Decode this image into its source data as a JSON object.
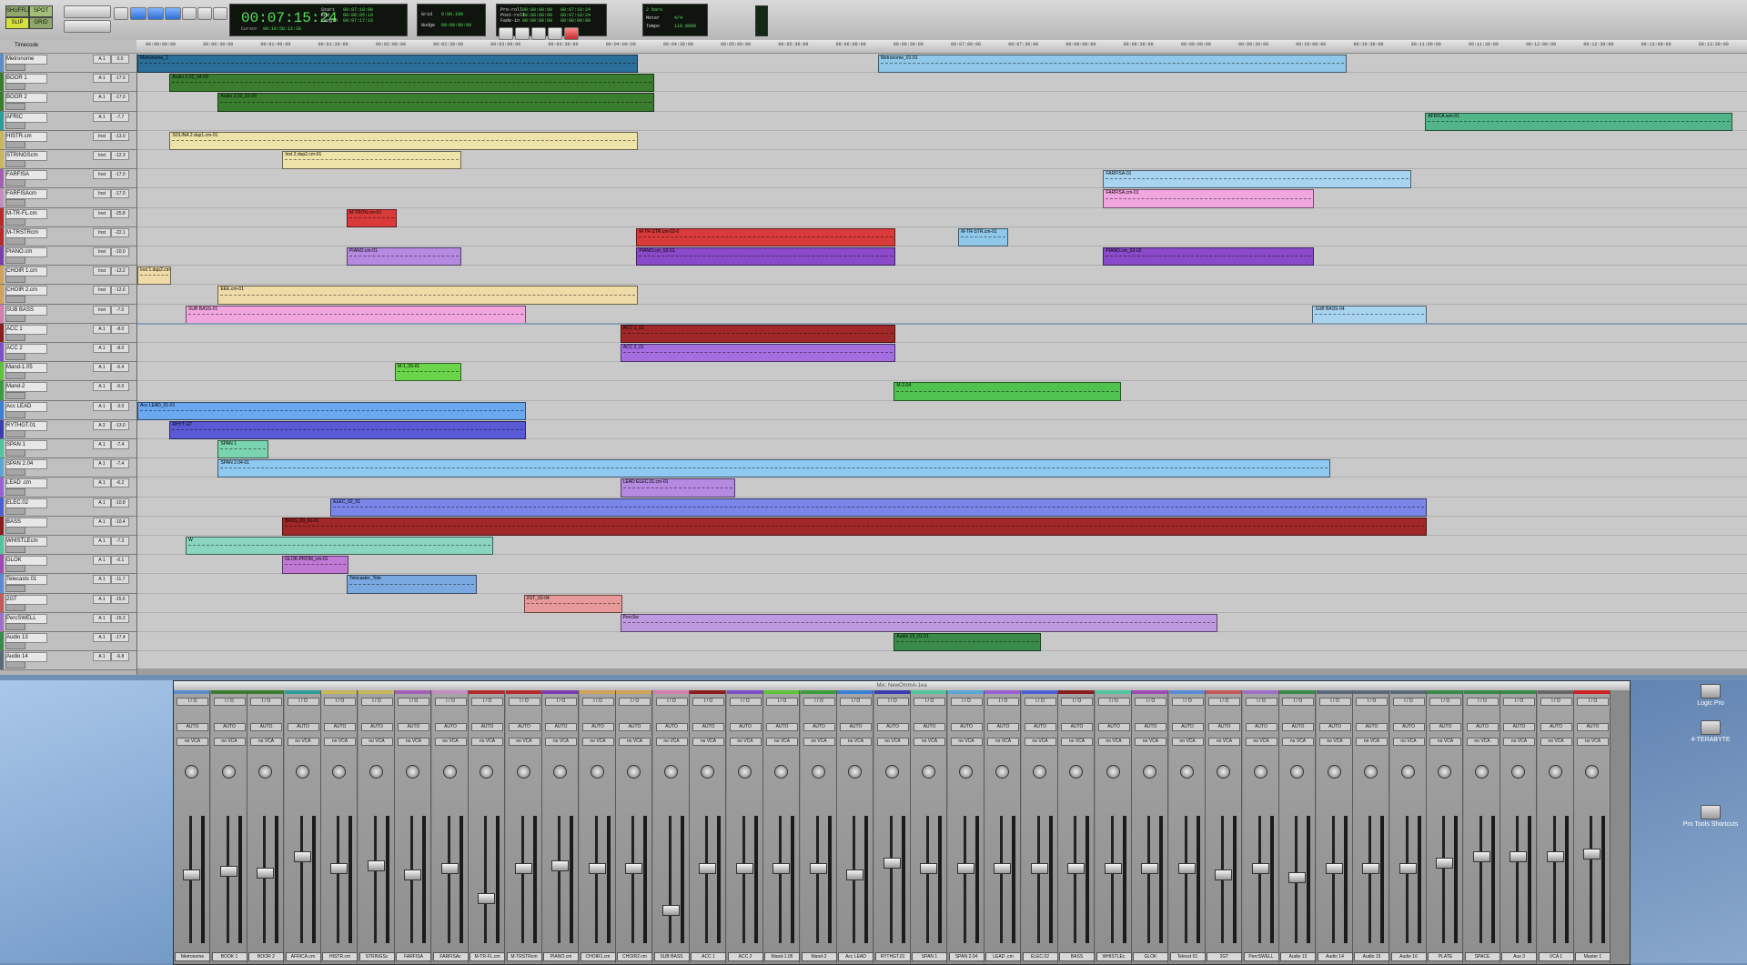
{
  "toolbar": {
    "modes": [
      "SHUFFLE",
      "SPOT",
      "SLIP",
      "GRID"
    ],
    "main_counter": "00:07:15:24",
    "start_label": "Start",
    "end_label": "End",
    "length_label": "Length",
    "start": "00:07:18:00",
    "end": "00:08:05:10",
    "length": "00:07:17:16",
    "cursor_label": "Cursor",
    "cursor": "00:10:58:12:28",
    "grid_label": "Grid",
    "grid": "0:00.100",
    "nudge_label": "Nudge",
    "nudge": "00:00:00:00",
    "preroll_label": "Pre-roll",
    "postroll_label": "Post-roll",
    "fadein_label": "Fade-in",
    "preroll": "00:00:00:00",
    "postroll": "00:00:00:00",
    "fadein": "00:00:00:00",
    "tstart": "00:07:18:24",
    "tend": "00:07:18:24",
    "tlength": "00:00:00:00",
    "meter_label": "Meter",
    "tempo_label": "Tempo",
    "meter": "4/4",
    "tempo": "110.0000",
    "countoff": "2 bars"
  },
  "ruler": {
    "timecode_label": "Timecode",
    "ticks": [
      "00:00:00:00",
      "00:00:30:00",
      "00:01:00:00",
      "00:01:30:00",
      "00:02:00:00",
      "00:02:30:00",
      "00:03:00:00",
      "00:03:30:00",
      "00:04:00:00",
      "00:04:30:00",
      "00:05:00:00",
      "00:05:30:00",
      "00:06:00:00",
      "00:06:30:00",
      "00:07:00:00",
      "00:07:30:00",
      "00:08:00:00",
      "00:08:30:00",
      "00:09:00:00",
      "00:09:30:00",
      "00:10:00:00",
      "00:10:30:00",
      "00:11:00:00",
      "00:11:30:00",
      "00:12:00:00",
      "00:12:30:00",
      "00:13:00:00",
      "00:13:30:00"
    ]
  },
  "tracks": [
    {
      "name": "Metronome",
      "color": "#5b8dc9",
      "input": "A 1",
      "vol": "0.0"
    },
    {
      "name": "BOOR 1",
      "color": "#3a7d2f",
      "input": "A 1",
      "vol": "-17.0"
    },
    {
      "name": "BOOR 2",
      "color": "#3a7d2f",
      "input": "A 1",
      "vol": "-17.0"
    },
    {
      "name": "AFRIC",
      "color": "#2c9e9a",
      "input": "A 1",
      "vol": "-7.7"
    },
    {
      "name": "HISTR.cm",
      "color": "#c9b85a",
      "input": "Inst",
      "vol": "-13.0"
    },
    {
      "name": "STRINGScm",
      "color": "#c9b85a",
      "input": "Inst",
      "vol": "-12.3"
    },
    {
      "name": "FARFISA",
      "color": "#a35fb5",
      "input": "Inst",
      "vol": "-17.0"
    },
    {
      "name": "FARFISAcm",
      "color": "#c68dbf",
      "input": "Inst",
      "vol": "-17.0"
    },
    {
      "name": "M-TR-FL.cm",
      "color": "#b52a2a",
      "input": "Inst",
      "vol": "-25.8"
    },
    {
      "name": "M-TRSTRcm",
      "color": "#b52a2a",
      "input": "Inst",
      "vol": "-22.1"
    },
    {
      "name": "PIANO.cm",
      "color": "#7a3cb0",
      "input": "Inst",
      "vol": "-10.0"
    },
    {
      "name": "CHOIR 1.cm",
      "color": "#d1a25a",
      "input": "Inst",
      "vol": "-13.2"
    },
    {
      "name": "CHOIR 2.cm",
      "color": "#d1a25a",
      "input": "Inst",
      "vol": "-12.0"
    },
    {
      "name": "SUB BASS",
      "color": "#d27fb0",
      "input": "Inst",
      "vol": "-7.0"
    },
    {
      "name": "ACC 1",
      "color": "#8a1e1e",
      "input": "A 1",
      "vol": "-8.0"
    },
    {
      "name": "ACC 2",
      "color": "#7d4fc9",
      "input": "A 1",
      "vol": "-8.0"
    },
    {
      "name": "Mand-1.05",
      "color": "#5fc23b",
      "input": "A 1",
      "vol": "-6.4"
    },
    {
      "name": "Mand-2",
      "color": "#3a9c3a",
      "input": "A 1",
      "vol": "-6.0"
    },
    {
      "name": "Acc LEAD",
      "color": "#3b7ed6",
      "input": "A 1",
      "vol": "-3.0"
    },
    {
      "name": "RYTHGT.01",
      "color": "#3a3cb0",
      "input": "A 2",
      "vol": "-13.0"
    },
    {
      "name": "SPAN 1",
      "color": "#52c49a",
      "input": "A 1",
      "vol": "-7.4"
    },
    {
      "name": "SPAN 2.04",
      "color": "#5aa6d6",
      "input": "A 1",
      "vol": "-7.4"
    },
    {
      "name": "LEAD .cm",
      "color": "#9b5fd6",
      "input": "A 1",
      "vol": "-6.2"
    },
    {
      "name": "ELEC.02",
      "color": "#4a5fd6",
      "input": "A 1",
      "vol": "-10.8"
    },
    {
      "name": "BASS",
      "color": "#8a1e1e",
      "input": "A 1",
      "vol": "-10.4"
    },
    {
      "name": "WHISTLEcm",
      "color": "#52c4a0",
      "input": "A 1",
      "vol": "-7.3"
    },
    {
      "name": "GLOK",
      "color": "#a04ab5",
      "input": "A 1",
      "vol": "-0.1"
    },
    {
      "name": "Telecasts 01",
      "color": "#5a8bd6",
      "input": "A 1",
      "vol": "-11.7"
    },
    {
      "name": "2GT",
      "color": "#c25a5a",
      "input": "A 1",
      "vol": "-15.6"
    },
    {
      "name": "PercSWELL",
      "color": "#a070c9",
      "input": "A 1",
      "vol": "-15.2"
    },
    {
      "name": "Audio 13",
      "color": "#3a8a4a",
      "input": "A 1",
      "vol": "-17.4"
    },
    {
      "name": "Audio 14",
      "color": "#5b6a7a",
      "input": "A 1",
      "vol": "-6.8"
    }
  ],
  "regions": [
    {
      "track": 0,
      "name": "Metronome_1",
      "color": "#2a6f9a",
      "start": 0.0,
      "end": 0.31
    },
    {
      "track": 0,
      "name": "Metronome_01-01",
      "color": "#8fc8e8",
      "start": 0.46,
      "end": 0.75
    },
    {
      "track": 1,
      "name": "Audio 2.02_04-09",
      "color": "#3a7d2f",
      "start": 0.02,
      "end": 0.32
    },
    {
      "track": 2,
      "name": "Audio 3.02_03-09",
      "color": "#3a7d2f",
      "start": 0.05,
      "end": 0.32
    },
    {
      "track": 3,
      "name": "AFRICA.wm-01",
      "color": "#52b58a",
      "start": 0.8,
      "end": 0.99
    },
    {
      "track": 4,
      "name": "SOLINA 2.dup1.cm-01",
      "color": "#eee3a8",
      "start": 0.02,
      "end": 0.31
    },
    {
      "track": 5,
      "name": "Inst 2.dup2.cm-01",
      "color": "#eee3a8",
      "start": 0.09,
      "end": 0.2
    },
    {
      "track": 6,
      "name": "FARFISA-01",
      "color": "#a8d4f0",
      "start": 0.6,
      "end": 0.79
    },
    {
      "track": 7,
      "name": "FARFISA.cm-01",
      "color": "#f2a6e0",
      "start": 0.6,
      "end": 0.73
    },
    {
      "track": 8,
      "name": "M-TRON.cm-01",
      "color": "#d93a3a",
      "start": 0.13,
      "end": 0.16
    },
    {
      "track": 9,
      "name": "M-TR-STR.cm-02-0",
      "color": "#d93a3a",
      "start": 0.31,
      "end": 0.47
    },
    {
      "track": 9,
      "name": "M-TR-STR.cm-01",
      "color": "#8fc8e8",
      "start": 0.51,
      "end": 0.54
    },
    {
      "track": 10,
      "name": "PIANO.cm-01",
      "color": "#b58ae0",
      "start": 0.13,
      "end": 0.2
    },
    {
      "track": 10,
      "name": "PIANO.cm_02-01",
      "color": "#8a4ac9",
      "start": 0.31,
      "end": 0.47
    },
    {
      "track": 10,
      "name": "PIANO.cm_02-02",
      "color": "#8a4ac9",
      "start": 0.6,
      "end": 0.73
    },
    {
      "track": 11,
      "name": "Inst 1.dup2.cm",
      "color": "#eedba8",
      "start": 0.0,
      "end": 0.02
    },
    {
      "track": 12,
      "name": "EEE.cm-01",
      "color": "#eedba8",
      "start": 0.05,
      "end": 0.31
    },
    {
      "track": 13,
      "name": "SUB BASS-01",
      "color": "#f2a6e0",
      "start": 0.03,
      "end": 0.24
    },
    {
      "track": 13,
      "name": "SUB BASS-04",
      "color": "#a8d4f0",
      "start": 0.73,
      "end": 0.8
    },
    {
      "track": 14,
      "name": "ACC 1_01",
      "color": "#a02828",
      "start": 0.3,
      "end": 0.47
    },
    {
      "track": 15,
      "name": "ACC 2_01",
      "color": "#a46ee0",
      "start": 0.3,
      "end": 0.47
    },
    {
      "track": 16,
      "name": "M-1_05-01",
      "color": "#6ad44a",
      "start": 0.16,
      "end": 0.2
    },
    {
      "track": 17,
      "name": "M-2.04",
      "color": "#4fc24f",
      "start": 0.47,
      "end": 0.61
    },
    {
      "track": 18,
      "name": "Acc LEAD_01-01",
      "color": "#6aa8f0",
      "start": 0.0,
      "end": 0.24
    },
    {
      "track": 19,
      "name": "RHYT GT",
      "color": "#5a5ad6",
      "start": 0.02,
      "end": 0.24
    },
    {
      "track": 20,
      "name": "SPAN 1",
      "color": "#7ad4b0",
      "start": 0.05,
      "end": 0.08
    },
    {
      "track": 21,
      "name": "SPAN 2.04-01",
      "color": "#8fc8f0",
      "start": 0.05,
      "end": 0.74
    },
    {
      "track": 22,
      "name": "LEAD ELEC.01.cm-01",
      "color": "#b58ae0",
      "start": 0.3,
      "end": 0.37
    },
    {
      "track": 23,
      "name": "ELEC_02_01",
      "color": "#7a86e8",
      "start": 0.12,
      "end": 0.8
    },
    {
      "track": 24,
      "name": "BASS_03_01-01",
      "color": "#a02828",
      "start": 0.09,
      "end": 0.8
    },
    {
      "track": 25,
      "name": "W",
      "color": "#8ad4c0",
      "start": 0.03,
      "end": 0.22
    },
    {
      "track": 26,
      "name": "GLOK-PROM_cm-01",
      "color": "#c07ad6",
      "start": 0.09,
      "end": 0.13
    },
    {
      "track": 27,
      "name": "Telecaster_Tele",
      "color": "#7aa8e0",
      "start": 0.13,
      "end": 0.21
    },
    {
      "track": 28,
      "name": "2GT_02-04",
      "color": "#e89a9a",
      "start": 0.24,
      "end": 0.3
    },
    {
      "track": 29,
      "name": "PercSw",
      "color": "#c09ae0",
      "start": 0.3,
      "end": 0.67
    },
    {
      "track": 30,
      "name": "Audio 13_01-01",
      "color": "#3a8a4a",
      "start": 0.47,
      "end": 0.56
    }
  ],
  "mixer": {
    "title": "Mix: NewOmmA-1ea",
    "strips": [
      "Metronome",
      "BOOK 1",
      "BOOR 2",
      "AFRICA.cm",
      "HISTR.cm",
      "STRINGSc",
      "FARFISA",
      "FARFISAc",
      "M-TR-FL.cm",
      "M-TRSTRcm",
      "PIANO.cm",
      "CHOIR1.cm",
      "CHOIR2.cm",
      "SUB BASS",
      "ACC 1",
      "ACC 2",
      "Mand-1.05",
      "Mand-2",
      "Acc LEAD",
      "RYTHGT.01",
      "SPAN 1",
      "SPAN 2.04",
      "LEAD .cm",
      "ELEC.02",
      "BASS",
      "WHISTLEc",
      "GLOK",
      "Telecst 01",
      "2GT",
      "PercSWELL",
      "Audio 13",
      "Audio 14",
      "Audio 15",
      "Audio 16",
      "PLATE",
      "SPACE",
      "Aux 3",
      "VCA 1",
      "Master 1"
    ],
    "strip_io": "I / O",
    "strip_auto": "AUTO",
    "strip_vca": "no VCA"
  },
  "desktop_icons": [
    "Logic Pro",
    "4-TERABYTE",
    "Pro Tools Shortcuts"
  ]
}
